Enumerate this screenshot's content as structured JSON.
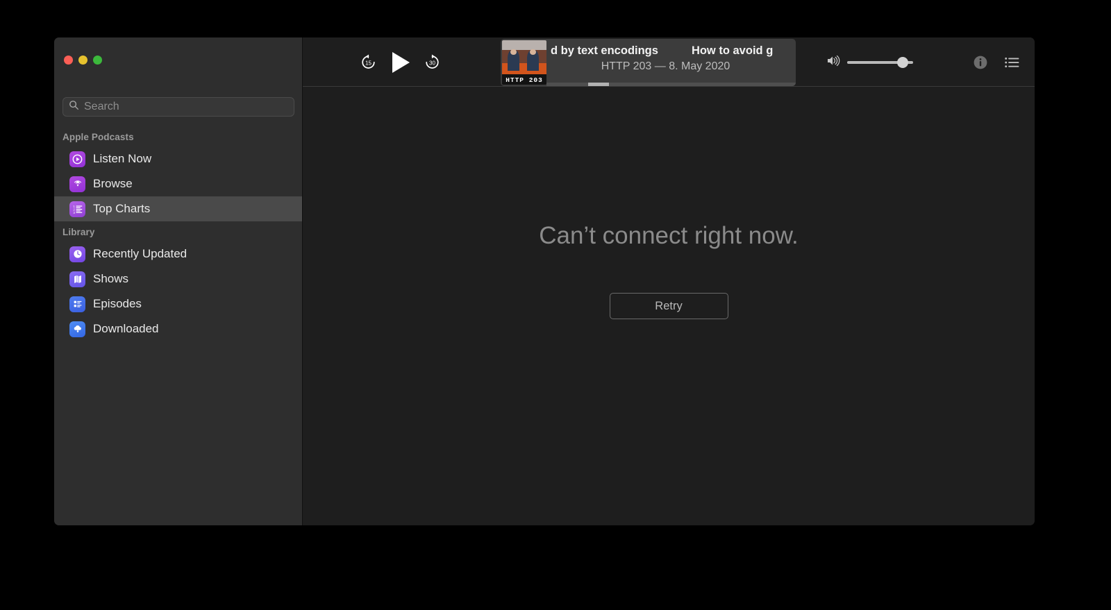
{
  "window": {
    "traffic_lights": [
      {
        "name": "close",
        "color": "#fb5f56"
      },
      {
        "name": "minimize",
        "color": "#e6c22e"
      },
      {
        "name": "zoom",
        "color": "#3cb93c"
      }
    ]
  },
  "sidebar": {
    "search": {
      "icon": "search-icon",
      "placeholder": "Search",
      "value": ""
    },
    "sections": [
      {
        "header": "Apple Podcasts",
        "items": [
          {
            "label": "Listen Now",
            "icon": "play-circle-icon",
            "selected": false
          },
          {
            "label": "Browse",
            "icon": "podcast-icon",
            "selected": false
          },
          {
            "label": "Top Charts",
            "icon": "numbered-list-icon",
            "selected": true
          }
        ]
      },
      {
        "header": "Library",
        "items": [
          {
            "label": "Recently Updated",
            "icon": "clock-icon",
            "selected": false
          },
          {
            "label": "Shows",
            "icon": "books-icon",
            "selected": false
          },
          {
            "label": "Episodes",
            "icon": "list-detail-icon",
            "selected": false
          },
          {
            "label": "Downloaded",
            "icon": "cloud-download-icon",
            "selected": false
          }
        ]
      }
    ]
  },
  "toolbar": {
    "transport": [
      {
        "name": "skip-back-15-button",
        "label": "15"
      },
      {
        "name": "play-button",
        "label": ""
      },
      {
        "name": "skip-forward-30-button",
        "label": "30"
      }
    ],
    "now_playing": {
      "artwork_caption": "HTTP 203",
      "title_part_1": "d by text encodings",
      "title_part_2": "How to avoid g",
      "subtitle": "HTTP 203 — 8. May 2020"
    },
    "volume": {
      "icon": "speaker-wave-icon",
      "level": 76
    },
    "buttons": [
      {
        "name": "info-button",
        "icon": "info-circle-icon"
      },
      {
        "name": "queue-button",
        "icon": "queue-list-icon"
      }
    ]
  },
  "content": {
    "error_title": "Can’t connect right now.",
    "retry_label": "Retry"
  }
}
